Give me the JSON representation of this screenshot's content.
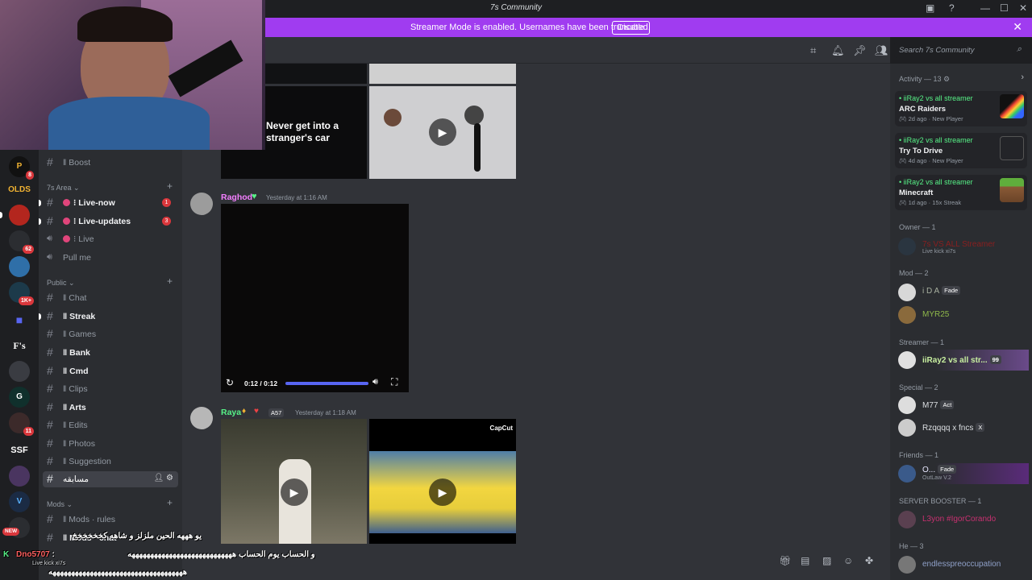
{
  "window": {
    "title": "7s Community"
  },
  "banner": {
    "text": "Streamer Mode is enabled. Usernames have been truncated.",
    "disable_label": "Disable"
  },
  "search": {
    "placeholder": "Search 7s Community"
  },
  "servers": {
    "olds_label": "OLDS",
    "fs_label": "F's",
    "ssf_label": "SSF",
    "badges": [
      "8",
      "62",
      "1K+",
      "11"
    ],
    "new_label": "NEW"
  },
  "channels": {
    "boost": "Boost",
    "cat_7s": "7s Area",
    "live_now": "Live-now",
    "live_now_count": "1",
    "live_updates": "Live-updates",
    "live_updates_count": "3",
    "live": "Live",
    "pull_me": "Pull me",
    "cat_public": "Public",
    "chat": "Chat",
    "streak": "Streak",
    "games": "Games",
    "bank": "Bank",
    "cmd": "Cmd",
    "arts": "Arts",
    "clips": "Clips",
    "edits": "Edits",
    "photos": "Photos",
    "suggestion": "Suggestion",
    "selected": "مسابقه",
    "cat_mods": "Mods",
    "mods_rules": "Mods · rules",
    "mods_chat": "Mods · chat"
  },
  "messages": [
    {
      "author": "Raghod",
      "time": "Yesterday at 1:16 AM",
      "name_color": "#f47fff"
    },
    {
      "author": "Raya",
      "tag": "A57",
      "time": "Yesterday at 1:18 AM",
      "name_color": "#57f287"
    }
  ],
  "media": {
    "clip_caption": "Never get into a stranger's car",
    "video_time": "0:12 / 0:12",
    "video_progress": 1.0,
    "capcut_label": "CapCut"
  },
  "activity": {
    "header": "Activity — 13",
    "cards": [
      {
        "streamer": "iiRay2 vs all streamer",
        "game": "ARC Raiders",
        "ago": "2d ago",
        "status": "New Player"
      },
      {
        "streamer": "iiRay2 vs all streamer",
        "game": "Try To Drive",
        "ago": "4d ago",
        "status": "New Player"
      },
      {
        "streamer": "iiRay2 vs all streamer",
        "game": "Minecraft",
        "ago": "1d ago",
        "status": "15x Streak"
      }
    ]
  },
  "members": {
    "owner_header": "Owner — 1",
    "owner": {
      "name": "7s VS ALL Streamer",
      "sub": "Live kick xi7s"
    },
    "mod_header": "Mod — 2",
    "mod1": {
      "name": "i D A",
      "tag": "Fade"
    },
    "mod2": {
      "name": "MYR25"
    },
    "streamer_header": "Streamer — 1",
    "streamer": {
      "name": "iiRay2 vs all str...",
      "tag": "99"
    },
    "special_header": "Special — 2",
    "special1": {
      "name": "M77",
      "tag": "Act"
    },
    "special2": {
      "name": "Rzqqqq x fncs",
      "tag": "X"
    },
    "friends_header": "Friends — 1",
    "friend": {
      "name": "O...",
      "tag": "Fade",
      "sub": "OutLaw V.2"
    },
    "booster_header": "SERVER BOOSTER — 1",
    "booster": {
      "name": "L3yon #IgorCorando"
    },
    "he_header": "He — 3",
    "he1": {
      "name": "endlesspreoccupation"
    }
  },
  "stream_overlay": {
    "line1": "يو هههه الحين ملزلز و شاهه كخخخخخخ",
    "user": "Dno5707",
    "line2": "و الحساب يوم الحساب ههههههههههههههههههههههههههههه",
    "line3": "ههههههههههههههههههههههههههههههههههههه",
    "sub": "Live kick xi7s"
  }
}
